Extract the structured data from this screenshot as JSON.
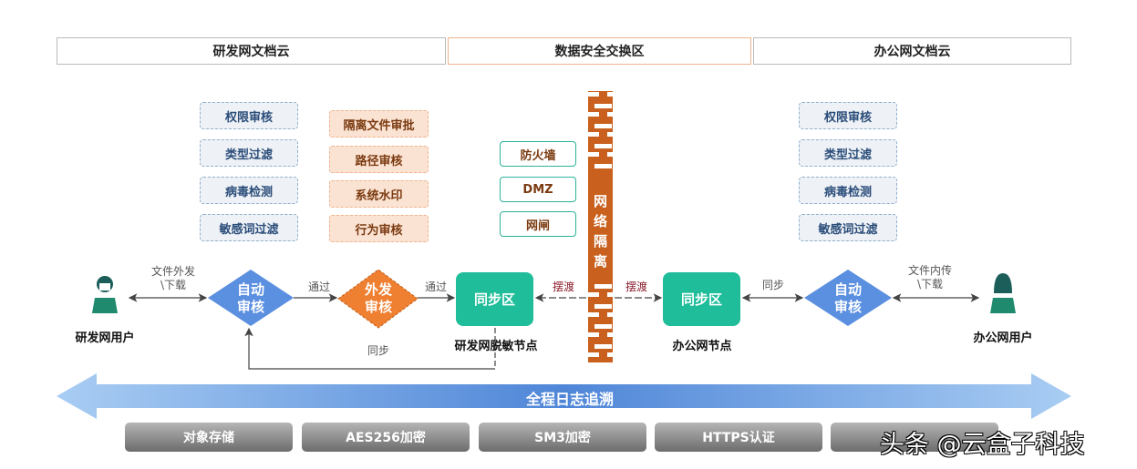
{
  "zones": [
    "研发网文档云",
    "数据安全交换区",
    "办公网文档云"
  ],
  "left_checks": [
    "权限审核",
    "类型过滤",
    "病毒检测",
    "敏感词过滤"
  ],
  "outbound_checks": [
    "隔离文件审批",
    "路径审核",
    "系统水印",
    "行为审核"
  ],
  "dmz_items": [
    "防火墙",
    "DMZ",
    "网闸"
  ],
  "wall_label": "网络隔离",
  "right_checks": [
    "权限审核",
    "类型过滤",
    "病毒检测",
    "敏感词过滤"
  ],
  "flow": {
    "left_user": "研发网用户",
    "left_user_edge": "文件外发\\下载",
    "left_auto": "自动审核",
    "pass1": "通过",
    "outbound_review": "外发审核",
    "pass2": "通过",
    "left_sync": "同步区",
    "left_node": "研发网脱敏节点",
    "sync_back": "同步",
    "ferry_left": "摆渡",
    "ferry_right": "摆渡",
    "right_sync": "同步区",
    "right_node": "办公网节点",
    "right_sync_edge": "同步",
    "right_auto": "自动审核",
    "right_user_edge": "文件内传\\下载",
    "right_user": "办公网用户"
  },
  "log_arrow": "全程日志追溯",
  "tech": [
    "对象存储",
    "AES256加密",
    "SM3加密",
    "HTTPS认证",
    ""
  ],
  "watermark": "头条 @云盒子科技",
  "colors": {
    "blue": "#5b8fe0",
    "orange": "#ef7f31",
    "teal": "#1fbd9a",
    "wall": "#c9601d"
  }
}
